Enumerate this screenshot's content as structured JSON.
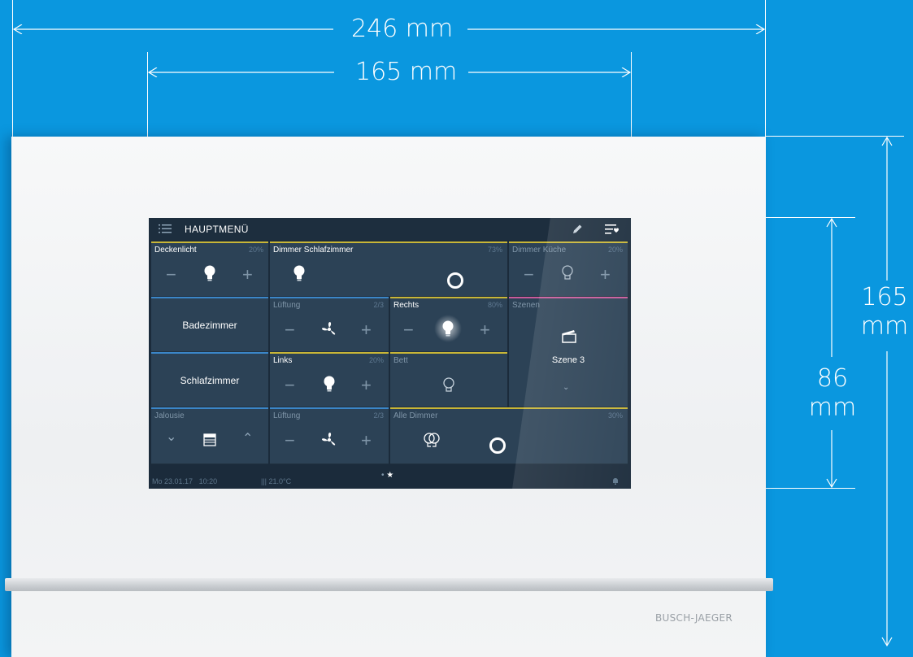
{
  "dimensions": {
    "total_width": "246 mm",
    "screen_width": "165 mm",
    "total_height_value": "165",
    "total_height_unit": "mm",
    "screen_height_value": "86",
    "screen_height_unit": "mm"
  },
  "brand": "BUSCH-JAEGER",
  "screen": {
    "title": "HAUPTMENÜ",
    "tiles": {
      "deckenlicht": {
        "label": "Deckenlicht",
        "pct": "20%"
      },
      "dimmer_schlaf": {
        "label": "Dimmer Schlafzimmer",
        "pct": "73%"
      },
      "dimmer_kueche": {
        "label": "Dimmer Küche",
        "pct": "20%"
      },
      "badezimmer": {
        "label": "Badezimmer"
      },
      "lueftung1": {
        "label": "Lüftung",
        "pct": "2/3"
      },
      "rechts": {
        "label": "Rechts",
        "pct": "80%"
      },
      "szenen": {
        "label": "Szenen",
        "value": "Szene 3"
      },
      "schlafzimmer": {
        "label": "Schlafzimmer"
      },
      "links": {
        "label": "Links",
        "pct": "20%"
      },
      "bett": {
        "label": "Bett"
      },
      "jalousie": {
        "label": "Jalousie"
      },
      "lueftung2": {
        "label": "Lüftung",
        "pct": "2/3"
      },
      "alle_dimmer": {
        "label": "Alle Dimmer",
        "pct": "30%"
      }
    },
    "status": {
      "date": "Mo 23.01.17",
      "time": "10:20",
      "temperature": "21.0°C"
    }
  },
  "colors": {
    "background": "#0a97df",
    "accent_yellow": "#c8b637",
    "accent_blue": "#3b86c8",
    "accent_pink": "#c85a9b"
  }
}
